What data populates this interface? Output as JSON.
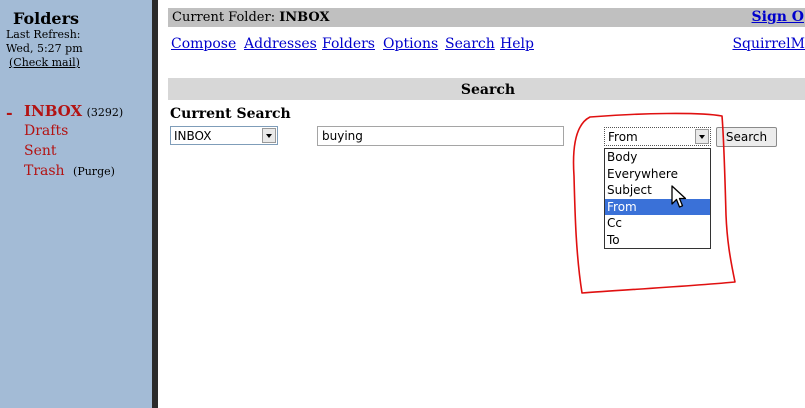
{
  "sidebar": {
    "title": "Folders",
    "last_refresh_label": "Last Refresh:",
    "last_refresh_time": "Wed, 5:27 pm",
    "check_mail": "(Check mail)",
    "folders": [
      {
        "name": "INBOX",
        "count": "(3292)"
      },
      {
        "name": "Drafts"
      },
      {
        "name": "Sent"
      },
      {
        "name": "Trash",
        "action": "(Purge)"
      }
    ]
  },
  "header": {
    "current_folder_label": "Current Folder:",
    "current_folder": "INBOX",
    "sign_out": "Sign O",
    "product": "SquirrelM"
  },
  "nav": [
    "Compose",
    "Addresses",
    "Folders",
    "Options",
    "Search",
    "Help"
  ],
  "search": {
    "header": "Search",
    "current_search_label": "Current Search",
    "folder_select": "INBOX",
    "query": "buying",
    "field_select": "From",
    "button": "Search",
    "options": [
      "Body",
      "Everywhere",
      "Subject",
      "From",
      "Cc",
      "To"
    ],
    "highlighted_option": "From"
  },
  "colors": {
    "sidebar_bg": "#a3bbd6",
    "folder_red": "#b31313",
    "link_blue": "#0000cc",
    "highlight": "#3a71d8",
    "annotation": "#e01010"
  }
}
